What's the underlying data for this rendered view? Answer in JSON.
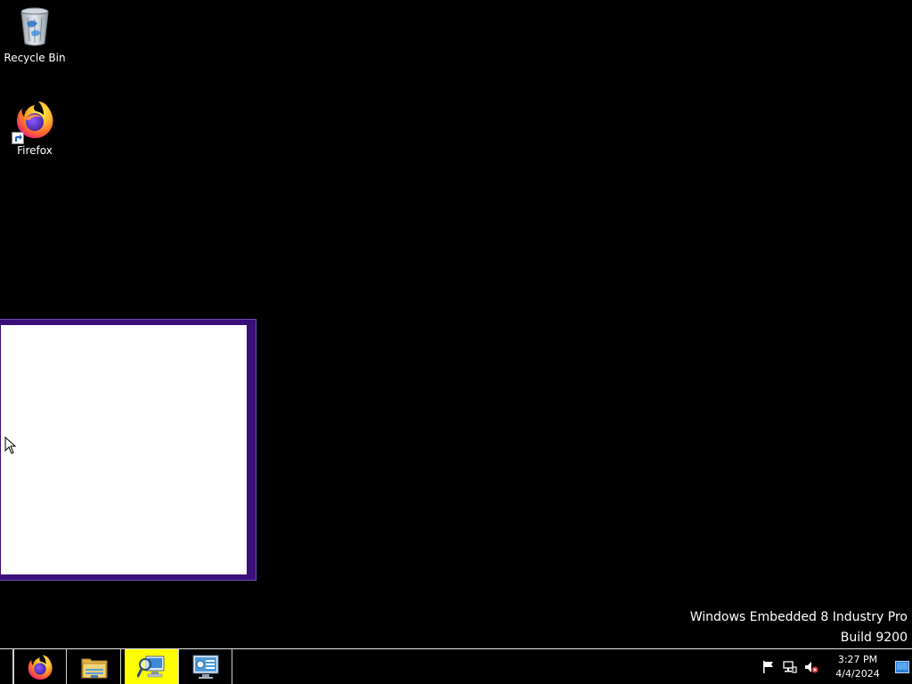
{
  "desktop": {
    "icons": [
      {
        "label": "Recycle Bin",
        "icon": "recycle-bin-icon"
      },
      {
        "label": "Firefox",
        "icon": "firefox-icon"
      }
    ],
    "watermark": {
      "line1": "Windows Embedded 8 Industry Pro",
      "line2": "Build 9200"
    }
  },
  "taskbar": {
    "buttons": [
      {
        "icon": "firefox-icon",
        "active": false
      },
      {
        "icon": "file-explorer-icon",
        "active": false
      },
      {
        "icon": "search-computer-icon",
        "active": true
      },
      {
        "icon": "control-panel-icon",
        "active": false
      }
    ],
    "tray": {
      "icons": [
        "action-center-flag-icon",
        "network-icon",
        "volume-muted-icon"
      ],
      "time": "3:27 PM",
      "date": "4/4/2024"
    }
  },
  "colors": {
    "desktop_background": "#000000",
    "window_border": "#3a0f7a",
    "active_taskbar_button": "#ffff00"
  }
}
